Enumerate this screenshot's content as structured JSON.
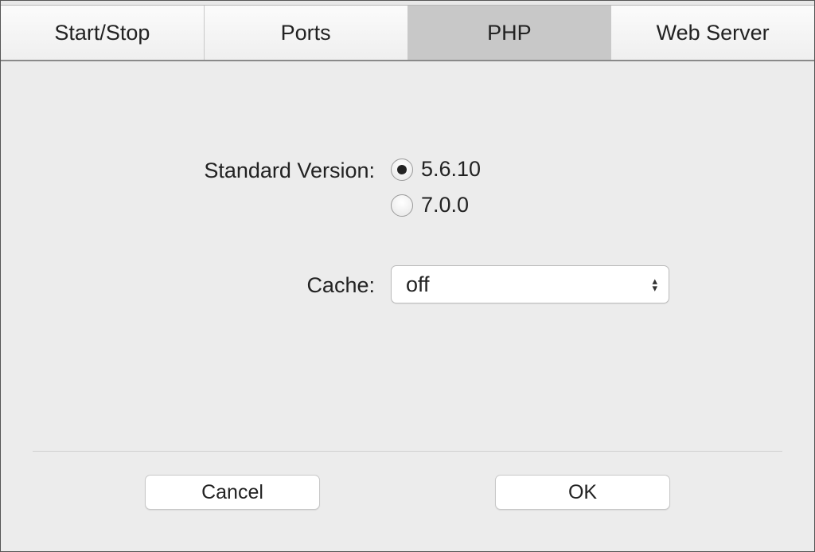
{
  "tabs": [
    {
      "label": "Start/Stop",
      "active": false
    },
    {
      "label": "Ports",
      "active": false
    },
    {
      "label": "PHP",
      "active": true
    },
    {
      "label": "Web Server",
      "active": false
    }
  ],
  "form": {
    "version_label": "Standard Version:",
    "version_options": [
      {
        "label": "5.6.10",
        "selected": true
      },
      {
        "label": "7.0.0",
        "selected": false
      }
    ],
    "cache_label": "Cache:",
    "cache_value": "off"
  },
  "buttons": {
    "cancel": "Cancel",
    "ok": "OK"
  }
}
